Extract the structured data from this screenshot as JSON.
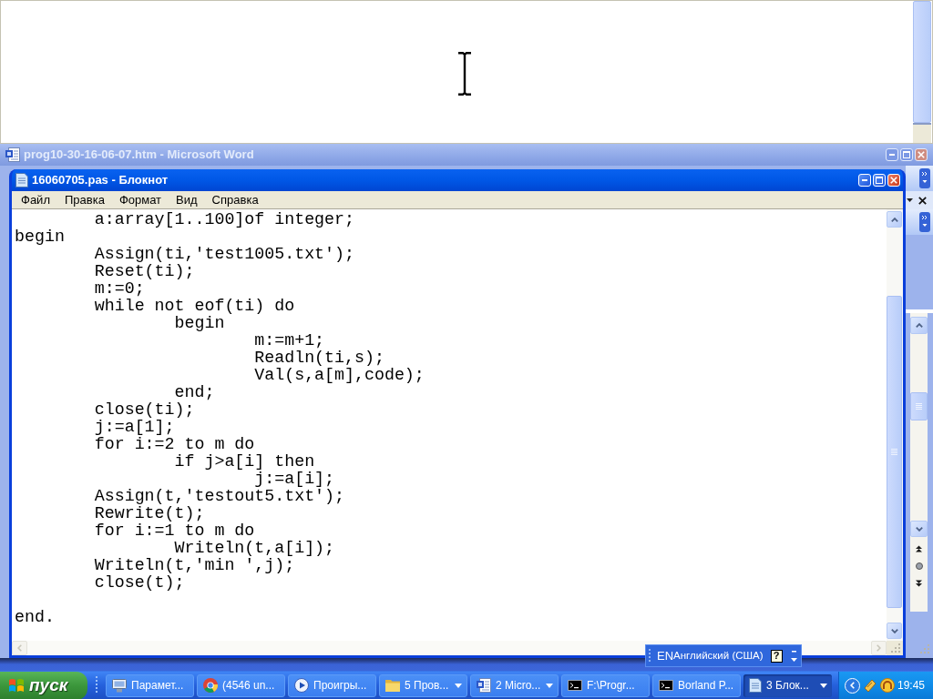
{
  "word_window": {
    "title": "prog10-30-16-06-07.htm - Microsoft Word",
    "active": false
  },
  "notepad": {
    "title": "16060705.pas - Блокнот",
    "active": true,
    "menu": [
      "Файл",
      "Правка",
      "Формат",
      "Вид",
      "Справка"
    ],
    "code_blocks": [
      [
        "\ta:array[1..100]of integer;",
        "begin",
        "\tAssign(ti,'test1005.txt');",
        "\tReset(ti);",
        "\tm:=0;",
        "\twhile not eof(ti) do",
        "\t\tbegin",
        "\t\t\tm:=m+1;",
        "\t\t\tReadln(ti,s);",
        "\t\t\tVal(s,a[m],code);",
        "\t\tend;",
        "\tclose(ti);",
        "\tj:=a[1];",
        "\tfor i:=2 to m do",
        "\t\tif j>a[i] then",
        "\t\t\tj:=a[i];",
        "\tAssign(t,'testout5.txt');",
        "\tRewrite(t);",
        "\tfor i:=1 to m do",
        "\t\tWriteln(t,a[i]);",
        "\tWriteln(t,'min ',j);",
        "\tclose(t);"
      ],
      [
        "end."
      ]
    ]
  },
  "language_bar": {
    "code": "EN",
    "language": "Английский (США)",
    "help": "?"
  },
  "taskbar": {
    "start": "пуск",
    "buttons": [
      {
        "label": "Парамет...",
        "kind": "settings",
        "selected": false,
        "grouped": false
      },
      {
        "label": "(4546 un...",
        "kind": "browser",
        "selected": false,
        "grouped": false
      },
      {
        "label": "Проигры...",
        "kind": "player",
        "selected": false,
        "grouped": false
      },
      {
        "label": "5 Пров...",
        "kind": "folder",
        "selected": false,
        "grouped": true
      },
      {
        "label": "2 Micro...",
        "kind": "word",
        "selected": false,
        "grouped": true
      },
      {
        "label": "F:\\Progr...",
        "kind": "console",
        "selected": false,
        "grouped": false
      },
      {
        "label": "Borland P...",
        "kind": "console",
        "selected": false,
        "grouped": false
      },
      {
        "label": "3 Блок...",
        "kind": "notepad",
        "selected": true,
        "grouped": true
      }
    ],
    "clock": "19:45"
  }
}
